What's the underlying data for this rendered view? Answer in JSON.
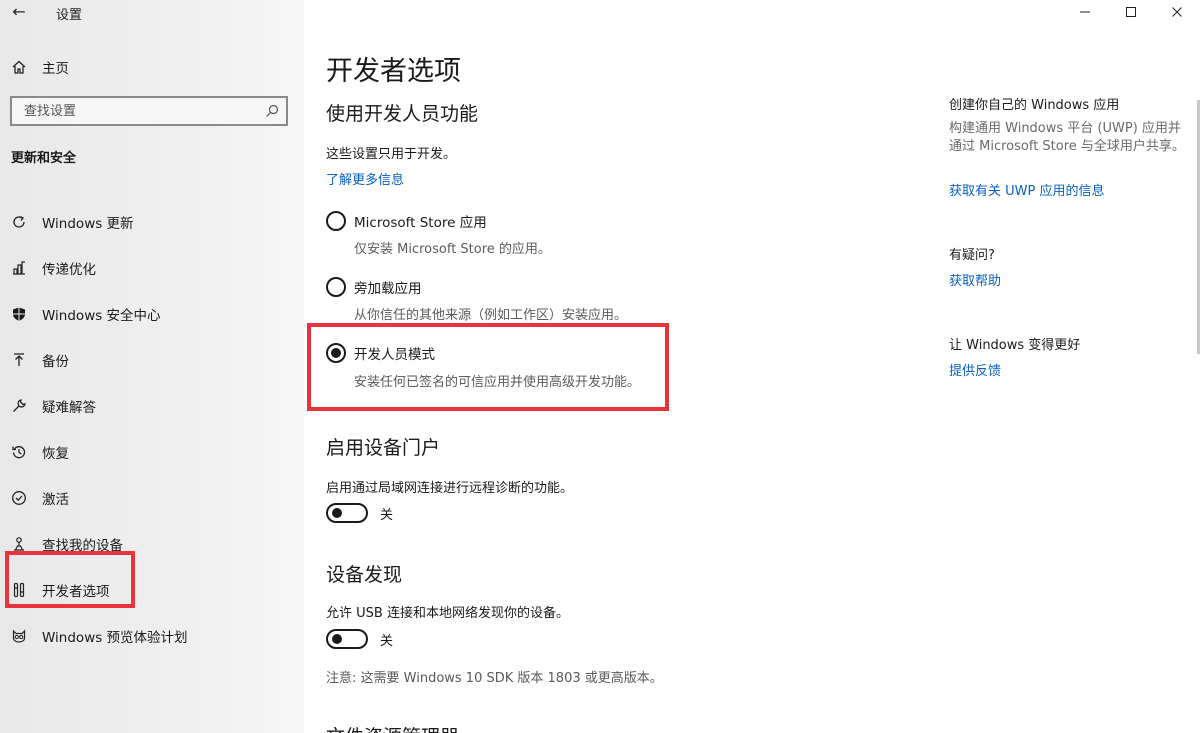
{
  "window": {
    "title": "设置",
    "back_glyph": "←"
  },
  "sidebar": {
    "home_label": "主页",
    "search_placeholder": "查找设置",
    "section_header": "更新和安全",
    "items": [
      {
        "label": "Windows 更新",
        "icon": "refresh-icon"
      },
      {
        "label": "传递优化",
        "icon": "delivery-optimization-icon"
      },
      {
        "label": "Windows 安全中心",
        "icon": "shield-icon"
      },
      {
        "label": "备份",
        "icon": "backup-arrow-icon"
      },
      {
        "label": "疑难解答",
        "icon": "wrench-icon"
      },
      {
        "label": "恢复",
        "icon": "recovery-icon"
      },
      {
        "label": "激活",
        "icon": "check-circle-icon"
      },
      {
        "label": "查找我的设备",
        "icon": "find-device-icon"
      },
      {
        "label": "开发者选项",
        "icon": "developer-tools-icon"
      },
      {
        "label": "Windows 预览体验计划",
        "icon": "insider-cat-icon"
      }
    ]
  },
  "main": {
    "title": "开发者选项",
    "dev_features": {
      "title": "使用开发人员功能",
      "description": "这些设置只用于开发。",
      "learn_more": "了解更多信息",
      "options": [
        {
          "label": "Microsoft Store 应用",
          "desc": "仅安装 Microsoft Store 的应用。",
          "selected": false
        },
        {
          "label": "旁加载应用",
          "desc": "从你信任的其他来源（例如工作区）安装应用。",
          "selected": false
        },
        {
          "label": "开发人员模式",
          "desc": "安装任何已签名的可信应用并使用高级开发功能。",
          "selected": true
        }
      ]
    },
    "device_portal": {
      "title": "启用设备门户",
      "description": "启用通过局域网连接进行远程诊断的功能。",
      "toggle_state": "关"
    },
    "device_discovery": {
      "title": "设备发现",
      "description": "允许 USB 连接和本地网络发现你的设备。",
      "toggle_state": "关",
      "note": "注意: 这需要 Windows 10 SDK 版本 1803 或更高版本。"
    },
    "partial_section_title": "文件资源管理器"
  },
  "side_panel": {
    "uwp_head": "创建你自己的 Windows 应用",
    "uwp_desc": "构建通用 Windows 平台 (UWP) 应用并通过 Microsoft Store 与全球用户共享。",
    "uwp_link": "获取有关 UWP 应用的信息",
    "question_head": "有疑问?",
    "help_link": "获取帮助",
    "improve_head": "让 Windows 变得更好",
    "feedback_link": "提供反馈"
  },
  "colors": {
    "accent_link": "#0a5fc4",
    "highlight": "#e8343a"
  }
}
